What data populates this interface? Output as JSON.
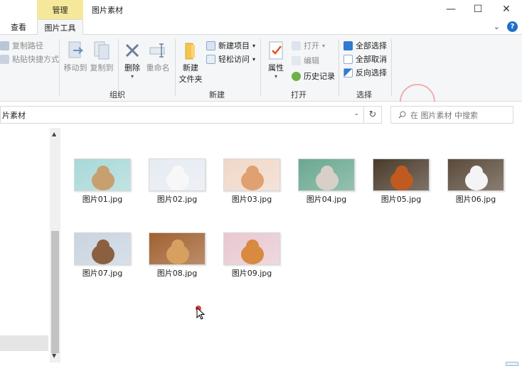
{
  "titlebar": {
    "context_tab": "管理",
    "title": "图片素材",
    "minimize": "—",
    "maximize": "☐",
    "close": "✕"
  },
  "tabs": {
    "view": "查看",
    "picture_tools": "图片工具",
    "expand": "⌄",
    "help": "?"
  },
  "ribbon": {
    "organize": {
      "copy_path": "复制路径",
      "paste_shortcut": "粘贴快捷方式",
      "move_to": "移动到",
      "copy_to": "复制到",
      "delete": "删除",
      "rename": "重命名",
      "label": "组织"
    },
    "new": {
      "new_folder_line1": "新建",
      "new_folder_line2": "文件夹",
      "new_item": "新建项目",
      "easy_access": "轻松访问",
      "label": "新建"
    },
    "open": {
      "properties": "属性",
      "open": "打开",
      "edit": "编辑",
      "history": "历史记录",
      "label": "打开"
    },
    "select": {
      "select_all": "全部选择",
      "select_none": "全部取消",
      "invert": "反向选择",
      "label": "选择"
    }
  },
  "address": {
    "path": "片素材",
    "refresh": "↻",
    "search_placeholder": "在 图片素材 中搜索"
  },
  "files": [
    {
      "name": "图片01.jpg",
      "icon": "cat-photo",
      "colors": [
        "#a8d8d8",
        "#c8a070"
      ]
    },
    {
      "name": "图片02.jpg",
      "icon": "arctic-fox-photo",
      "colors": [
        "#e6ebf2",
        "#f7f7f7"
      ]
    },
    {
      "name": "图片03.jpg",
      "icon": "hamster-photo",
      "colors": [
        "#f0d8c8",
        "#e0a070"
      ]
    },
    {
      "name": "图片04.jpg",
      "icon": "kitten-photo",
      "colors": [
        "#6aa890",
        "#d8d0c8"
      ]
    },
    {
      "name": "图片05.jpg",
      "icon": "red-panda-photo",
      "colors": [
        "#4a3a2a",
        "#c05a20"
      ]
    },
    {
      "name": "图片06.jpg",
      "icon": "panda-photo",
      "colors": [
        "#5a4a3a",
        "#f4f4f4"
      ]
    },
    {
      "name": "图片07.jpg",
      "icon": "dog-photo",
      "colors": [
        "#c8d4e0",
        "#8a6040"
      ]
    },
    {
      "name": "图片08.jpg",
      "icon": "puppies-photo",
      "colors": [
        "#a06030",
        "#d8a060"
      ]
    },
    {
      "name": "图片09.jpg",
      "icon": "corgi-photo",
      "colors": [
        "#e8c8d0",
        "#d88a40"
      ]
    }
  ]
}
